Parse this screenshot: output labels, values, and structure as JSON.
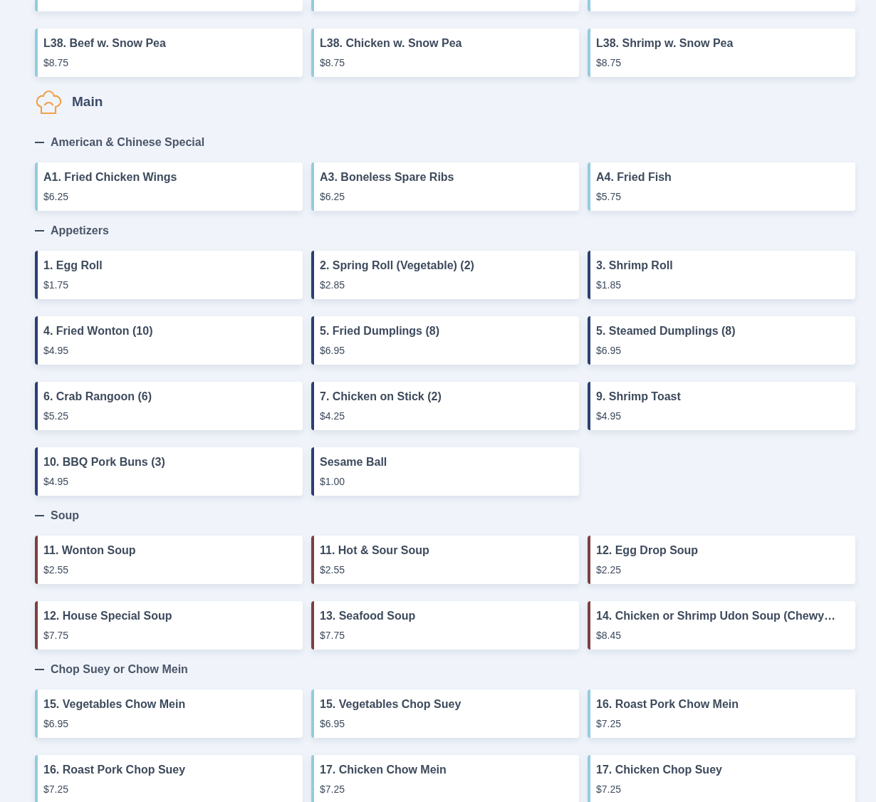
{
  "lunch_tail": {
    "color": "#92cbe0",
    "cut_off_cards": [
      {
        "kind": "cut_off"
      },
      {
        "kind": "cut_off"
      },
      {
        "kind": "cut_off"
      }
    ],
    "items": [
      {
        "name": "L38. Beef w. Snow Pea",
        "price": "$8.75"
      },
      {
        "name": "L38. Chicken w. Snow Pea",
        "price": "$8.75"
      },
      {
        "name": "L38. Shrimp w. Snow Pea",
        "price": "$8.75"
      }
    ]
  },
  "section": {
    "title": "Main",
    "groups": [
      {
        "title": "American & Chinese Special",
        "color": "#92cbe0",
        "items": [
          {
            "name": "A1. Fried Chicken Wings",
            "price": "$6.25"
          },
          {
            "name": "A3. Boneless Spare Ribs",
            "price": "$6.25"
          },
          {
            "name": "A4. Fried Fish",
            "price": "$5.75"
          }
        ]
      },
      {
        "title": "Appetizers",
        "color": "#2b3f73",
        "items": [
          {
            "name": "1. Egg Roll",
            "price": "$1.75"
          },
          {
            "name": "2. Spring Roll (Vegetable) (2)",
            "price": "$2.85"
          },
          {
            "name": "3. Shrimp Roll",
            "price": "$1.85"
          },
          {
            "name": "4. Fried Wonton (10)",
            "price": "$4.95"
          },
          {
            "name": "5. Fried Dumplings (8)",
            "price": "$6.95"
          },
          {
            "name": "5. Steamed Dumplings (8)",
            "price": "$6.95"
          },
          {
            "name": "6. Crab Rangoon (6)",
            "price": "$5.25"
          },
          {
            "name": "7. Chicken on Stick (2)",
            "price": "$4.25"
          },
          {
            "name": "9. Shrimp Toast",
            "price": "$4.95"
          },
          {
            "name": "10. BBQ Pork Buns (3)",
            "price": "$4.95"
          },
          {
            "name": "Sesame Ball",
            "price": "$1.00"
          }
        ]
      },
      {
        "title": "Soup",
        "color": "#7b4041",
        "items": [
          {
            "name": "11. Wonton Soup",
            "price": "$2.55"
          },
          {
            "name": "11. Hot & Sour Soup",
            "price": "$2.55"
          },
          {
            "name": "12. Egg Drop Soup",
            "price": "$2.25"
          },
          {
            "name": "12. House Special Soup",
            "price": "$7.75"
          },
          {
            "name": "13. Seafood Soup",
            "price": "$7.75"
          },
          {
            "name": "14. Chicken or Shrimp Udon Soup (Chewy…",
            "price": "$8.45"
          }
        ]
      },
      {
        "title": "Chop Suey or Chow Mein",
        "color": "#92cbe0",
        "items": [
          {
            "name": "15. Vegetables Chow Mein",
            "price": "$6.95"
          },
          {
            "name": "15. Vegetables Chop Suey",
            "price": "$6.95"
          },
          {
            "name": "16. Roast Pork Chow Mein",
            "price": "$7.25"
          },
          {
            "name": "16. Roast Pork Chop Suey",
            "price": "$7.25"
          },
          {
            "name": "17. Chicken Chow Mein",
            "price": "$7.25"
          },
          {
            "name": "17. Chicken Chop Suey",
            "price": "$7.25"
          }
        ]
      }
    ]
  }
}
